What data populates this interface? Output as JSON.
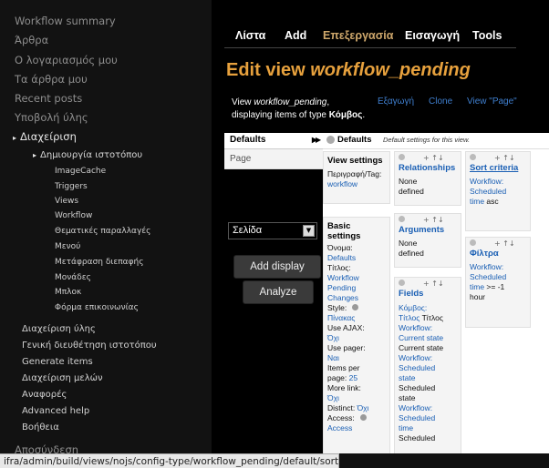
{
  "sidebar": {
    "items": [
      {
        "label": "Workflow summary"
      },
      {
        "label": "Άρθρα"
      },
      {
        "label": "Ο λογαριασμός μου"
      },
      {
        "label": "Τα άρθρα μου"
      },
      {
        "label": "Recent posts"
      },
      {
        "label": "Υποβολή ύλης"
      },
      {
        "label": "Διαχείριση"
      },
      {
        "label": "Δημιουργία ιστοτόπου"
      },
      {
        "label": "ImageCache"
      },
      {
        "label": "Triggers"
      },
      {
        "label": "Views"
      },
      {
        "label": "Workflow"
      },
      {
        "label": "Θεματικές παραλλαγές"
      },
      {
        "label": "Μενού"
      },
      {
        "label": "Μετάφραση διεπαφής"
      },
      {
        "label": "Μονάδες"
      },
      {
        "label": "Μπλοκ"
      },
      {
        "label": "Φόρμα επικοινωνίας"
      },
      {
        "label": "Διαχείριση ύλης"
      },
      {
        "label": "Γενική διευθέτηση ιστοτόπου"
      },
      {
        "label": "Generate items"
      },
      {
        "label": "Διαχείριση μελών"
      },
      {
        "label": "Αναφορές"
      },
      {
        "label": "Advanced help"
      },
      {
        "label": "Βοήθεια"
      },
      {
        "label": "Αποσύνδεση"
      }
    ]
  },
  "statusbar": {
    "url": "ifra/admin/build/views/nojs/config-type/workflow_pending/default/sort"
  },
  "tabs": [
    {
      "label": "Λίστα"
    },
    {
      "label": "Add"
    },
    {
      "label": "Επεξεργασία"
    },
    {
      "label": "Εισαγωγή"
    },
    {
      "label": "Tools"
    }
  ],
  "page_title": {
    "prefix": "Edit view ",
    "name": "workflow_pending"
  },
  "view_desc": {
    "p1": "View ",
    "name": "workflow_pending",
    "p2": ",",
    "p3": "displaying items of type ",
    "type": "Κόμβος",
    "p4": "."
  },
  "header_links": {
    "export": "Εξαγωγή",
    "clone": "Clone",
    "view_page": "View \"Page\""
  },
  "displays": {
    "defaults": "Defaults",
    "page": "Page"
  },
  "display_select": {
    "value": "Σελίδα"
  },
  "buttons": {
    "add_display": "Add display",
    "analyze": "Analyze"
  },
  "panel": {
    "name": "Defaults",
    "desc": "Default settings for this view."
  },
  "view_settings": {
    "title": "View settings",
    "line1": "Περιγραφή/Tag:",
    "line2": "workflow"
  },
  "basic_settings": {
    "title": "Basic settings",
    "lines": [
      {
        "t": "Όνομα:",
        "link": false
      },
      {
        "t": "Defaults",
        "link": true
      },
      {
        "t": "Τίτλος:",
        "link": false
      },
      {
        "t": "Workflow",
        "link": true
      },
      {
        "t": "Pending",
        "link": true
      },
      {
        "t": "Changes",
        "link": true
      },
      {
        "t": "Style:",
        "link": false
      },
      {
        "t": "Πίνακας",
        "link": true
      },
      {
        "t": "Use AJAX:",
        "link": false
      },
      {
        "t": "Όχι",
        "link": true
      },
      {
        "t": "Use pager:",
        "link": false
      },
      {
        "t": "Ναι",
        "link": true
      },
      {
        "t": "Items per",
        "link": false
      },
      {
        "t": "page: ",
        "link": false,
        "suffix": "25"
      },
      {
        "t": "More link:",
        "link": false
      },
      {
        "t": "Όχι",
        "link": true
      },
      {
        "t": "Distinct: ",
        "link": false,
        "suffix": "Όχι"
      },
      {
        "t": "Access:",
        "link": false
      },
      {
        "t": "Access",
        "link": true
      }
    ]
  },
  "relationships": {
    "title": "Relationships",
    "line1": "None",
    "line2": "defined"
  },
  "arguments": {
    "title": "Arguments",
    "line1": "None",
    "line2": "defined"
  },
  "fields": {
    "title": "Fields",
    "lines": [
      {
        "t": "Κόμβος:",
        "link": true
      },
      {
        "t": "Τίτλος ",
        "link": true,
        "plain": "Τίτλος"
      },
      {
        "t": "Workflow:",
        "link": true
      },
      {
        "t": "Current state",
        "link": true
      },
      {
        "t": "Current state",
        "link": false
      },
      {
        "t": "Workflow:",
        "link": true
      },
      {
        "t": "Scheduled",
        "link": true
      },
      {
        "t": "state",
        "link": true
      },
      {
        "t": "Scheduled",
        "link": false
      },
      {
        "t": "state",
        "link": false
      },
      {
        "t": "Workflow:",
        "link": true
      },
      {
        "t": "Scheduled",
        "link": true
      },
      {
        "t": "time",
        "link": true
      },
      {
        "t": "Scheduled",
        "link": false
      }
    ]
  },
  "sort_criteria": {
    "title": "Sort criteria",
    "lines": [
      {
        "t": "Workflow:",
        "link": true
      },
      {
        "t": "Scheduled",
        "link": true
      },
      {
        "t": "time ",
        "link": true,
        "plain": "asc"
      }
    ]
  },
  "filters": {
    "title": "Φίλτρα",
    "lines": [
      {
        "t": "Workflow:",
        "link": true
      },
      {
        "t": "Scheduled",
        "link": true
      },
      {
        "t": "time ",
        "link": true,
        "plain": ">= -1"
      },
      {
        "t": "hour",
        "link": false
      }
    ]
  },
  "colors": {
    "accent": "#e7a13d",
    "link": "#1a5fb4",
    "active_tab": "#cfa86c"
  }
}
